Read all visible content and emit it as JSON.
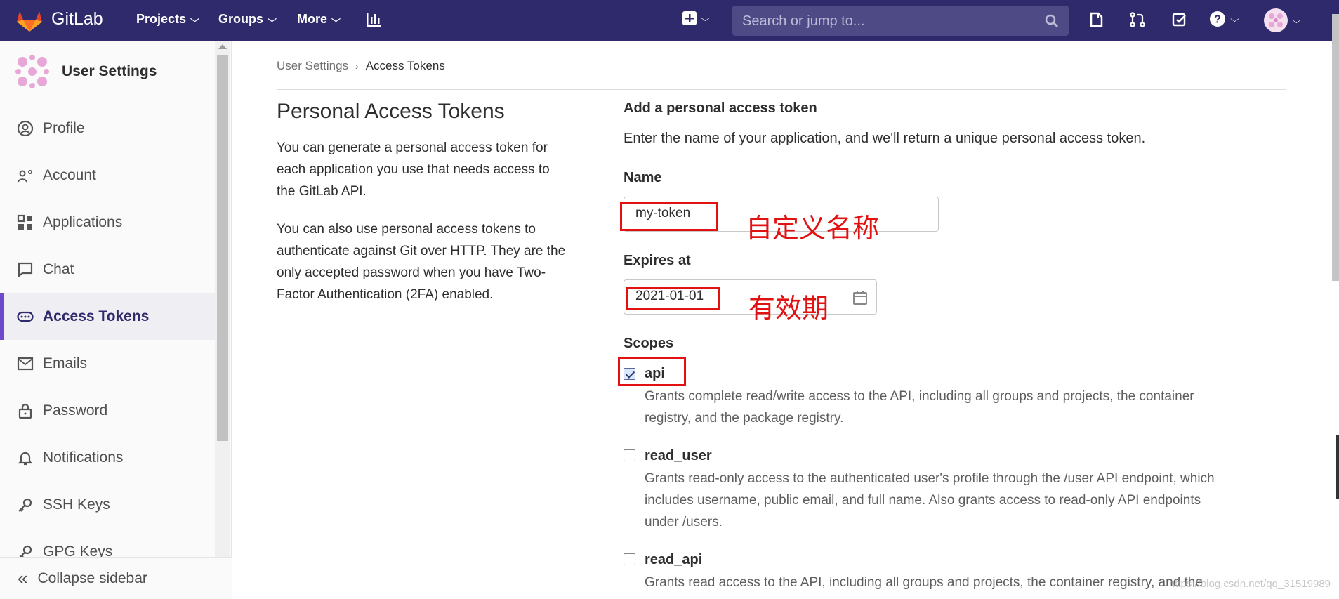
{
  "navbar": {
    "brand": "GitLab",
    "projects": "Projects",
    "groups": "Groups",
    "more": "More",
    "search_placeholder": "Search or jump to..."
  },
  "sidebar": {
    "title": "User Settings",
    "items": [
      {
        "label": "Profile",
        "icon": "profile-icon"
      },
      {
        "label": "Account",
        "icon": "account-icon"
      },
      {
        "label": "Applications",
        "icon": "applications-icon"
      },
      {
        "label": "Chat",
        "icon": "chat-icon"
      },
      {
        "label": "Access Tokens",
        "icon": "token-icon",
        "active": true
      },
      {
        "label": "Emails",
        "icon": "mail-icon"
      },
      {
        "label": "Password",
        "icon": "lock-icon"
      },
      {
        "label": "Notifications",
        "icon": "bell-icon"
      },
      {
        "label": "SSH Keys",
        "icon": "key-icon"
      },
      {
        "label": "GPG Keys",
        "icon": "key-icon"
      }
    ],
    "collapse": "Collapse sidebar"
  },
  "breadcrumb": {
    "parent": "User Settings",
    "current": "Access Tokens"
  },
  "intro": {
    "title": "Personal Access Tokens",
    "para1_l1": "You can generate a personal access token for",
    "para1_l2": "each application you use that needs access to",
    "para1_l3": "the GitLab API.",
    "para2_l1": "You can also use personal access tokens to",
    "para2_l2": "authenticate against Git over HTTP. They are the",
    "para2_l3": "only accepted password when you have Two-",
    "para2_l4": "Factor Authentication (2FA) enabled."
  },
  "form": {
    "heading": "Add a personal access token",
    "subheading": "Enter the name of your application, and we'll return a unique personal access token.",
    "name_label": "Name",
    "name_value": "my-token",
    "name_annotation": "自定义名称",
    "expires_label": "Expires at",
    "expires_value": "2021-01-01",
    "expires_annotation": "有效期",
    "scopes_label": "Scopes",
    "scopes": [
      {
        "name": "api",
        "checked": true,
        "desc_l1": "Grants complete read/write access to the API, including all groups and projects, the container",
        "desc_l2": "registry, and the package registry."
      },
      {
        "name": "read_user",
        "checked": false,
        "desc_l1": "Grants read-only access to the authenticated user's profile through the /user API endpoint, which",
        "desc_l2": "includes username, public email, and full name. Also grants access to read-only API endpoints",
        "desc_l3": "under /users."
      },
      {
        "name": "read_api",
        "checked": false,
        "desc_l1": "Grants read access to the API, including all groups and projects, the container registry, and the"
      }
    ]
  },
  "watermark": "https://blog.csdn.net/qq_31519989"
}
